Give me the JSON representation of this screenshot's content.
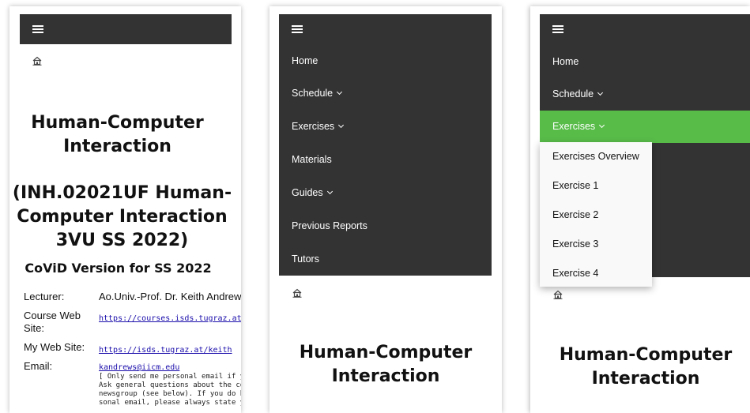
{
  "site": {
    "title": "Human-Computer Interaction",
    "title_line1": "Human-Computer",
    "title_line2": "Interaction",
    "course_line1": "(INH.02021UF Human-",
    "course_line2": "Computer Interaction",
    "course_line3": "3VU SS 2022)",
    "version": "CoViD Version for SS 2022"
  },
  "info": {
    "lecturer": {
      "label": "Lecturer:",
      "value": "Ao.Univ.-Prof. Dr. Keith Andrews"
    },
    "course_web_site": {
      "label_line1": "Course Web",
      "label_line2": "Site:",
      "value": "https://courses.isds.tugraz.at/hci/"
    },
    "my_web_site": {
      "label": "My Web Site:",
      "value": "https://isds.tugraz.at/keith"
    },
    "email": {
      "label": "Email:",
      "value": "kandrews@iicm.edu",
      "note_lines": [
        "[ Only send me personal email if you",
        "Ask general questions about the co",
        "newsgroup (see below). If you do h",
        "sonal email, please always state yo"
      ]
    }
  },
  "menu": {
    "items": [
      {
        "label": "Home",
        "has_submenu": false
      },
      {
        "label": "Schedule",
        "has_submenu": true
      },
      {
        "label": "Exercises",
        "has_submenu": true
      },
      {
        "label": "Materials",
        "has_submenu": false
      },
      {
        "label": "Guides",
        "has_submenu": true
      },
      {
        "label": "Previous Reports",
        "has_submenu": false
      },
      {
        "label": "Tutors",
        "has_submenu": false
      }
    ],
    "exercises_submenu": [
      "Exercises Overview",
      "Exercise 1",
      "Exercise 2",
      "Exercise 3",
      "Exercise 4"
    ]
  },
  "icons": {
    "menu": "hamburger-icon",
    "home": "home-icon",
    "submenu": "chevron-down-icon"
  },
  "colors": {
    "nav_background": "#333333",
    "nav_text": "#ffffff",
    "active_item": "#58bc49",
    "dropdown_background": "#f9f9f9",
    "link": "#1a0dab"
  }
}
